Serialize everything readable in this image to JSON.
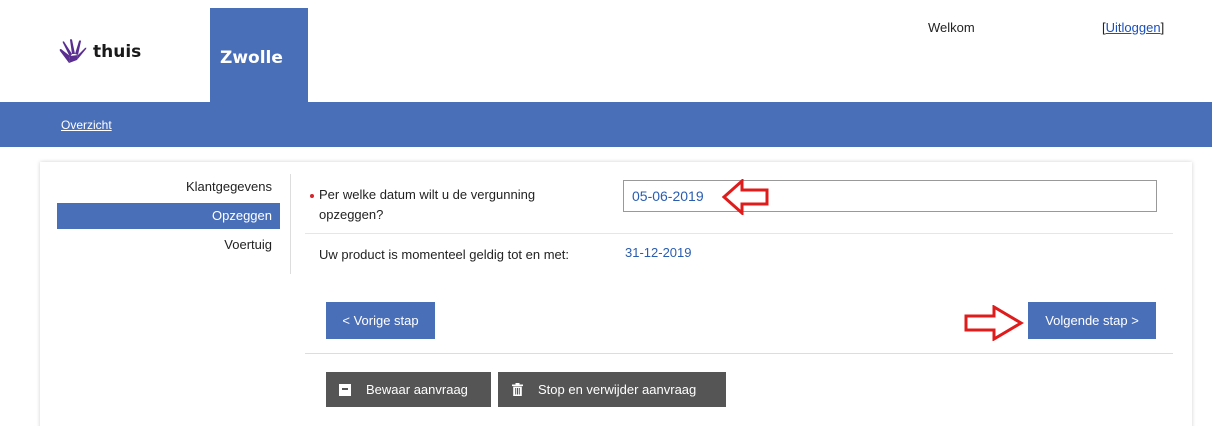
{
  "header": {
    "logo_text": "thuis",
    "city": "Zwolle",
    "welcome": "Welkom",
    "logout_open": "[",
    "logout_label": "Uitloggen",
    "logout_close": "]"
  },
  "nav": {
    "overview": "Overzicht"
  },
  "sidebar": {
    "items": [
      {
        "label": "Klantgegevens"
      },
      {
        "label": "Opzeggen",
        "active": true
      },
      {
        "label": "Voertuig"
      }
    ]
  },
  "form": {
    "date_label": "Per welke datum wilt u de vergunning opzeggen?",
    "date_value": "05-06-2019",
    "valid_label": "Uw product is momenteel geldig tot en met:",
    "valid_value": "31-12-2019"
  },
  "buttons": {
    "prev": "< Vorige stap",
    "next": "Volgende stap >",
    "save": "Bewaar aanvraag",
    "stop": "Stop en verwijder aanvraag"
  },
  "colors": {
    "brand_blue": "#4a6fb9",
    "dark_button": "#555555",
    "value_blue": "#2a5db0",
    "required": "#d4272d",
    "annotation_red": "#e01b1b"
  },
  "icons": {
    "logo": "hand-icon",
    "save": "save-icon",
    "stop": "trash-icon",
    "annotations": "arrow-left-icon, arrow-right-icon"
  }
}
